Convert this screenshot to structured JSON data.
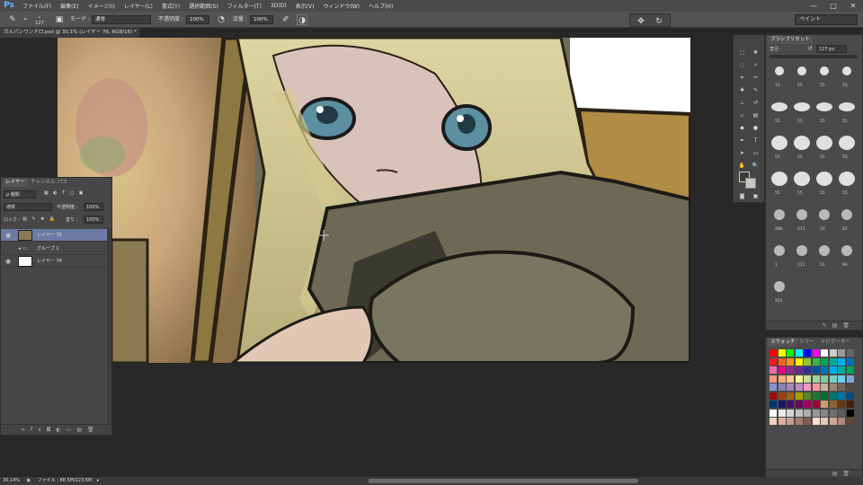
{
  "menubar": {
    "logo": "Ps",
    "items": [
      "ファイル(F)",
      "編集(E)",
      "イメージ(I)",
      "レイヤー(L)",
      "書式(Y)",
      "選択範囲(S)",
      "フィルター(T)",
      "3D(D)",
      "表示(V)",
      "ウィンドウ(W)",
      "ヘルプ(H)"
    ],
    "window_controls": [
      "—",
      "□",
      "✕"
    ]
  },
  "options": {
    "brush_size": "127",
    "mode_label": "モード :",
    "mode_value": "通常",
    "opacity_label": "不透明度 :",
    "opacity_value": "100%",
    "flow_label": "流量 :",
    "flow_value": "100%",
    "workspace": "ペイント"
  },
  "document_tab": "ガルパンワンドロ.psd @ 30.1% (レイヤー 76, RGB/16) *",
  "layers_panel": {
    "tabs": [
      "レイヤー",
      "チャンネル",
      "パス"
    ],
    "kind_label": "ρ 種類",
    "blend_mode": "通常",
    "opacity_label": "不透明度 :",
    "opacity_value": "100%",
    "lock_label": "ロック :",
    "fill_label": "塗り :",
    "fill_value": "100%",
    "layers": [
      {
        "name": "レイヤー 76",
        "selected": true
      },
      {
        "name": "グループ 1",
        "selected": false
      },
      {
        "name": "レイヤー 74",
        "selected": false
      }
    ],
    "footer_icons": [
      "link-icon",
      "fx-icon",
      "mask-icon",
      "adjustment-icon",
      "folder-icon",
      "new-layer-icon",
      "trash-icon"
    ]
  },
  "brush_panel": {
    "title": "ブラシプリセット",
    "size_label": "直径 :",
    "size_value": "127 px",
    "brush_sizes": [
      "15",
      "55",
      "55",
      "55",
      "55",
      "55",
      "55",
      "55",
      "55",
      "55",
      "55",
      "55",
      "55",
      "55",
      "55",
      "55",
      "486",
      "411",
      "26",
      "62",
      "1",
      "111",
      "51",
      "96",
      "201"
    ]
  },
  "swatches_panel": {
    "tabs": [
      "スウォッチ",
      "カラー",
      "ナビゲーター"
    ]
  },
  "statusbar": {
    "zoom": "30.14%",
    "file_info": "ファイル : 88.5M/223.6M"
  },
  "colors": {
    "accent_selected_layer": "#6b7ba3",
    "panel_bg": "#474747",
    "app_bg": "#282828"
  }
}
